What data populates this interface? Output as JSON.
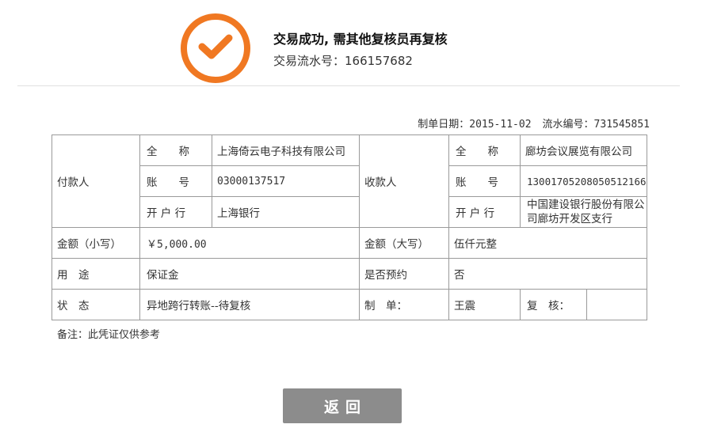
{
  "header": {
    "title": "交易成功, 需其他复核员再复核",
    "serial_label": "交易流水号：",
    "serial_value": "166157682",
    "icon": "checkmark-icon",
    "accent_color": "#f07822"
  },
  "meta": {
    "date_label": "制单日期：",
    "date_value": "2015-11-02",
    "serial_label": "流水编号：",
    "serial_value": "731545851"
  },
  "payer": {
    "label": "付款人",
    "name_label": "全　　称",
    "name_value": "上海倚云电子科技有限公司",
    "account_label": "账　　号",
    "account_value": "03000137517",
    "bank_label": "开 户 行",
    "bank_value": "上海银行"
  },
  "payee": {
    "label": "收款人",
    "name_label": "全　　称",
    "name_value": "廊坊会议展览有限公司",
    "account_label": "账　　号",
    "account_value": "130017052080505121​66",
    "bank_label": "开 户 行",
    "bank_value": "中国建设银行股份有限公司廊坊开发区支行"
  },
  "amount": {
    "small_label": "金额（小写）",
    "small_value": "￥5,000.00",
    "big_label": "金额（大写）",
    "big_value": "伍仟元整"
  },
  "purpose": {
    "label": "用　途",
    "value": "保证金",
    "reserve_label": "是否预约",
    "reserve_value": "否"
  },
  "status": {
    "label": "状　态",
    "value": "异地跨行转账--待复核",
    "maker_label": "制　单：",
    "maker_value": "王震",
    "checker_label": "复　核：",
    "checker_value": ""
  },
  "note": "备注：此凭证仅供参考",
  "back_button": "返回"
}
